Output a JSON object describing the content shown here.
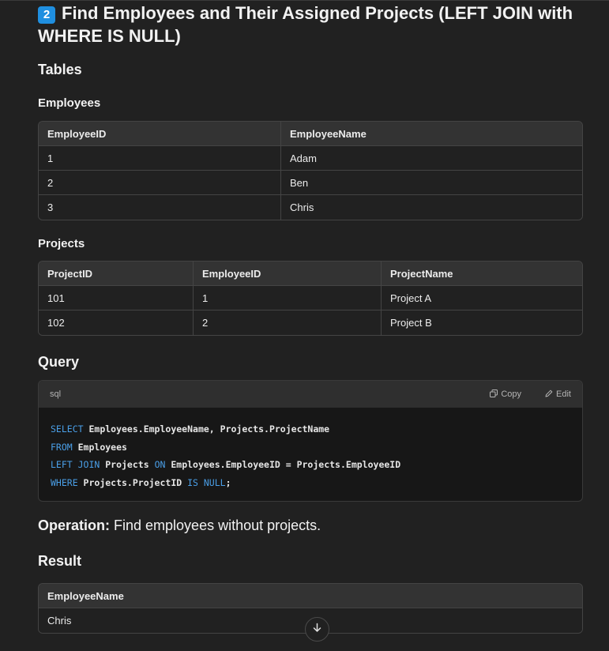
{
  "heading": {
    "badge": "2",
    "title": "Find Employees and Their Assigned Projects (LEFT JOIN with WHERE IS NULL)"
  },
  "tables_heading": "Tables",
  "employees": {
    "title": "Employees",
    "columns": [
      "EmployeeID",
      "EmployeeName"
    ],
    "rows": [
      [
        "1",
        "Adam"
      ],
      [
        "2",
        "Ben"
      ],
      [
        "3",
        "Chris"
      ]
    ]
  },
  "projects": {
    "title": "Projects",
    "columns": [
      "ProjectID",
      "EmployeeID",
      "ProjectName"
    ],
    "rows": [
      [
        "101",
        "1",
        "Project A"
      ],
      [
        "102",
        "2",
        "Project B"
      ]
    ]
  },
  "query": {
    "heading": "Query",
    "lang": "sql",
    "copy_label": "Copy",
    "edit_label": "Edit",
    "lines": [
      [
        {
          "k": "SELECT"
        },
        {
          "t": " Employees.EmployeeName, Projects.ProjectName"
        }
      ],
      [
        {
          "k": "FROM"
        },
        {
          "t": " Employees"
        }
      ],
      [
        {
          "k": "LEFT JOIN"
        },
        {
          "t": " Projects "
        },
        {
          "k": "ON"
        },
        {
          "t": " Employees.EmployeeID = Projects.EmployeeID"
        }
      ],
      [
        {
          "k": "WHERE"
        },
        {
          "t": " Projects.ProjectID "
        },
        {
          "k": "IS NULL"
        },
        {
          "t": ";"
        }
      ]
    ]
  },
  "operation": {
    "label": "Operation:",
    "text": " Find employees without projects."
  },
  "result": {
    "heading": "Result",
    "columns": [
      "EmployeeName"
    ],
    "rows": [
      [
        "Chris"
      ]
    ]
  },
  "colors": {
    "background": "#212121",
    "keyword": "#4a9fe8",
    "badge": "#1f8fe0"
  },
  "icons": [
    "copy-icon",
    "edit-icon",
    "arrow-down-icon"
  ]
}
